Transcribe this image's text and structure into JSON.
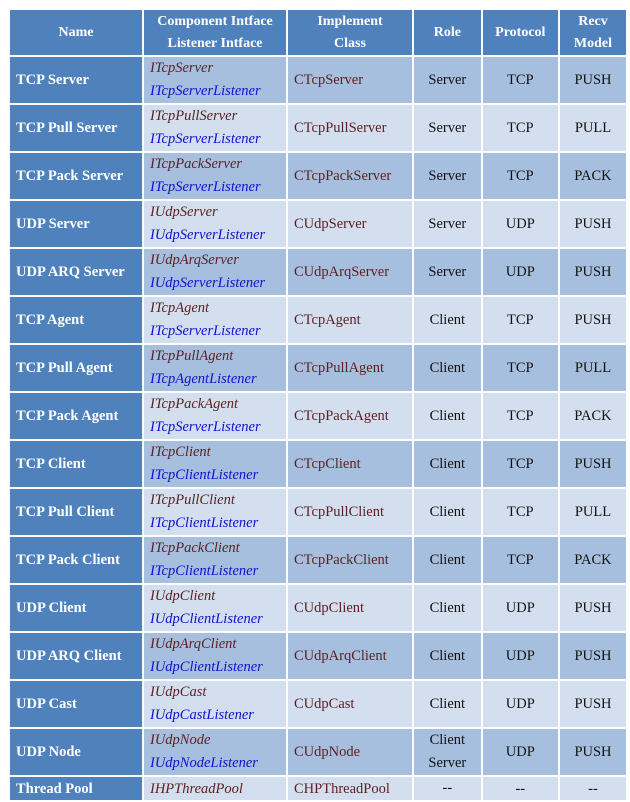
{
  "headers": {
    "name": "Name",
    "intf_line1": "Component Intface",
    "intf_line2": "Listener Intface",
    "class_line1": "Implement",
    "class_line2": "Class",
    "role": "Role",
    "protocol": "Protocol",
    "recv_line1": "Recv",
    "recv_line2": "Model"
  },
  "rows": [
    {
      "name": "TCP Server",
      "component": "ITcpServer",
      "listener": "ITcpServerListener",
      "class": "CTcpServer",
      "role": "Server",
      "protocol": "TCP",
      "recv": "PUSH"
    },
    {
      "name": "TCP Pull Server",
      "component": "ITcpPullServer",
      "listener": "ITcpServerListener",
      "class": "CTcpPullServer",
      "role": "Server",
      "protocol": "TCP",
      "recv": "PULL"
    },
    {
      "name": "TCP Pack Server",
      "component": "ITcpPackServer",
      "listener": "ITcpServerListener",
      "class": "CTcpPackServer",
      "role": "Server",
      "protocol": "TCP",
      "recv": "PACK"
    },
    {
      "name": "UDP Server",
      "component": "IUdpServer",
      "listener": "IUdpServerListener",
      "class": "CUdpServer",
      "role": "Server",
      "protocol": "UDP",
      "recv": "PUSH"
    },
    {
      "name": "UDP ARQ Server",
      "component": "IUdpArqServer",
      "listener": "IUdpServerListener",
      "class": "CUdpArqServer",
      "role": "Server",
      "protocol": "UDP",
      "recv": "PUSH"
    },
    {
      "name": "TCP Agent",
      "component": "ITcpAgent",
      "listener": "ITcpServerListener",
      "class": "CTcpAgent",
      "role": "Client",
      "protocol": "TCP",
      "recv": "PUSH"
    },
    {
      "name": "TCP Pull Agent",
      "component": "ITcpPullAgent",
      "listener": "ITcpAgentListener",
      "class": "CTcpPullAgent",
      "role": "Client",
      "protocol": "TCP",
      "recv": "PULL"
    },
    {
      "name": "TCP Pack Agent",
      "component": "ITcpPackAgent",
      "listener": "ITcpServerListener",
      "class": "CTcpPackAgent",
      "role": "Client",
      "protocol": "TCP",
      "recv": "PACK"
    },
    {
      "name": "TCP Client",
      "component": "ITcpClient",
      "listener": "ITcpClientListener",
      "class": "CTcpClient",
      "role": "Client",
      "protocol": "TCP",
      "recv": "PUSH"
    },
    {
      "name": "TCP Pull Client",
      "component": "ITcpPullClient",
      "listener": "ITcpClientListener",
      "class": "CTcpPullClient",
      "role": "Client",
      "protocol": "TCP",
      "recv": "PULL"
    },
    {
      "name": "TCP Pack Client",
      "component": "ITcpPackClient",
      "listener": "ITcpClientListener",
      "class": "CTcpPackClient",
      "role": "Client",
      "protocol": "TCP",
      "recv": "PACK"
    },
    {
      "name": "UDP Client",
      "component": "IUdpClient",
      "listener": "IUdpClientListener",
      "class": "CUdpClient",
      "role": "Client",
      "protocol": "UDP",
      "recv": "PUSH"
    },
    {
      "name": "UDP ARQ Client",
      "component": "IUdpArqClient",
      "listener": "IUdpClientListener",
      "class": "CUdpArqClient",
      "role": "Client",
      "protocol": "UDP",
      "recv": "PUSH"
    },
    {
      "name": "UDP Cast",
      "component": "IUdpCast",
      "listener": "IUdpCastListener",
      "class": "CUdpCast",
      "role": "Client",
      "protocol": "UDP",
      "recv": "PUSH"
    },
    {
      "name": "UDP Node",
      "component": "IUdpNode",
      "listener": "IUdpNodeListener",
      "class": "CUdpNode",
      "role": "Client",
      "role2": "Server",
      "protocol": "UDP",
      "recv": "PUSH"
    },
    {
      "name": "Thread Pool",
      "component": "IHPThreadPool",
      "class": "CHPThreadPool",
      "role": "--",
      "protocol": "--",
      "recv": "--"
    }
  ]
}
